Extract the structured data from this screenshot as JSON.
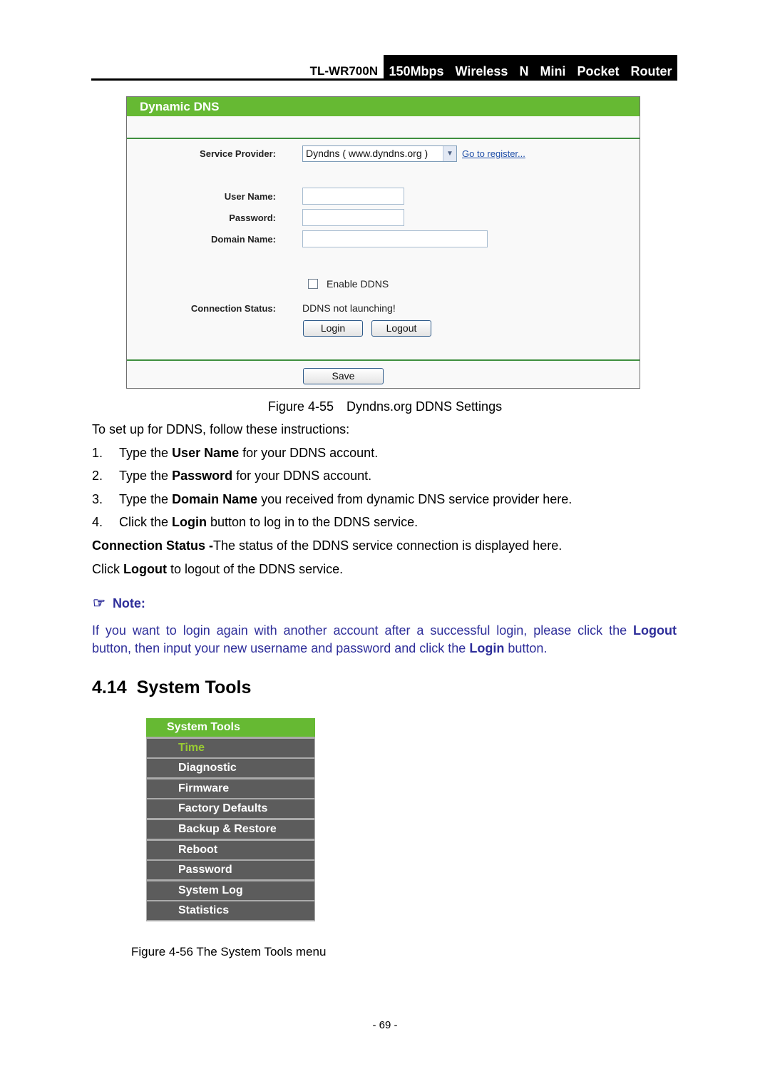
{
  "header": {
    "model": "TL-WR700N",
    "product": "150Mbps  Wireless  N  Mini  Pocket  Router"
  },
  "ddns_panel": {
    "title": "Dynamic DNS",
    "service_provider_label": "Service Provider:",
    "service_provider_value": "Dyndns ( www.dyndns.org )",
    "dropdown_arrow": "chevron-down",
    "register_link": "Go to register...",
    "user_name_label": "User Name:",
    "user_name_value": "",
    "password_label": "Password:",
    "password_value": "",
    "domain_name_label": "Domain Name:",
    "domain_name_value": "",
    "enable_ddns_label": "Enable DDNS",
    "enable_ddns_checked": false,
    "connection_status_label": "Connection Status:",
    "connection_status_value": "DDNS not launching!",
    "login_button": "Login",
    "logout_button": "Logout",
    "save_button": "Save"
  },
  "figure_55": {
    "number": "Figure 4-55",
    "title": "Dyndns.org DDNS Settings"
  },
  "instructions": {
    "intro": "To set up for DDNS, follow these instructions:",
    "steps": [
      {
        "num": "1.",
        "pre": "Type the ",
        "bold": "User Name",
        "post": " for your DDNS account."
      },
      {
        "num": "2.",
        "pre": "Type the ",
        "bold": "Password",
        "post": " for your DDNS account."
      },
      {
        "num": "3.",
        "pre": "Type the ",
        "bold": "Domain Name",
        "post": " you received from dynamic DNS service provider here."
      },
      {
        "num": "4.",
        "pre": "Click the ",
        "bold": "Login",
        "post": " button to log in to the DDNS service."
      }
    ],
    "status_bold": "Connection Status -",
    "status_text": "The status of the DDNS service connection is displayed here.",
    "logout_pre": "Click ",
    "logout_bold": "Logout",
    "logout_post": " to logout of the DDNS service."
  },
  "note": {
    "icon": "pointing-hand",
    "heading": "Note:",
    "line1_pre": "If you want to login again with another account after a successful login, please click the ",
    "line1_bold": "Logout",
    "line2_pre": "button, then input your new username and password and click the ",
    "line2_bold": "Login",
    "line2_post": " button."
  },
  "section": {
    "number": "4.14",
    "title": "System Tools"
  },
  "system_tools_menu": {
    "header": "System Tools",
    "items": [
      {
        "label": "Time",
        "active": true
      },
      {
        "label": "Diagnostic",
        "active": false
      },
      {
        "label": "Firmware",
        "active": false
      },
      {
        "label": "Factory Defaults",
        "active": false
      },
      {
        "label": "Backup & Restore",
        "active": false
      },
      {
        "label": "Reboot",
        "active": false
      },
      {
        "label": "Password",
        "active": false
      },
      {
        "label": "System Log",
        "active": false
      },
      {
        "label": "Statistics",
        "active": false
      }
    ]
  },
  "figure_56": {
    "caption": "Figure 4-56 The System Tools menu"
  },
  "page_number": "- 69 -",
  "colors": {
    "panel_green": "#66b933",
    "menu_gray": "#5c5c5c",
    "menu_active": "#99cc33",
    "note_blue": "#2e2e9a",
    "link_blue": "#1f4fa8"
  }
}
